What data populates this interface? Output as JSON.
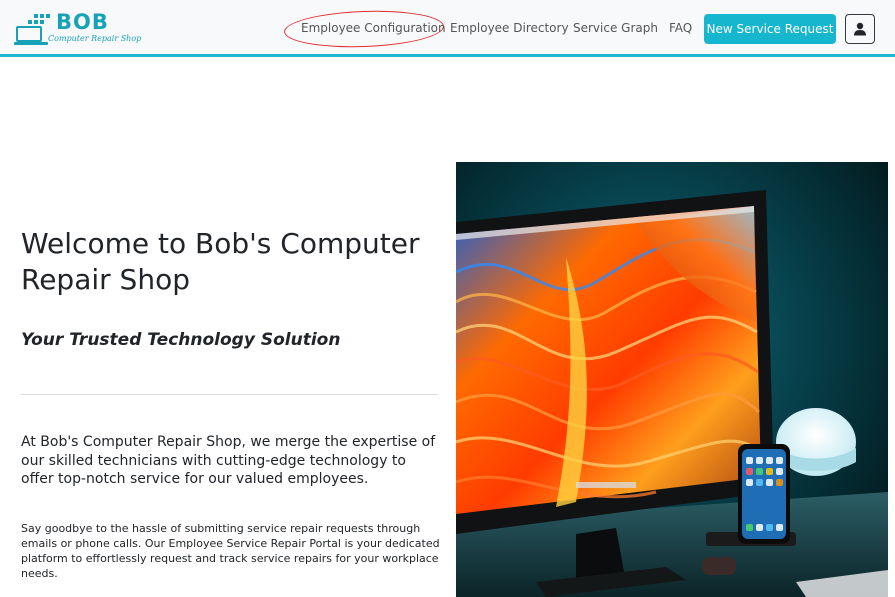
{
  "brand": {
    "name": "BOB",
    "tagline": "Computer Repair Shop",
    "color": "#17a2b8"
  },
  "nav": {
    "links": [
      {
        "label": "Employee Configuration"
      },
      {
        "label": "Employee Directory"
      },
      {
        "label": "Service Graph"
      },
      {
        "label": "FAQ"
      }
    ],
    "cta_label": "New Service Request",
    "accent_color": "#17b6cf",
    "user_icon": "user-icon"
  },
  "hero": {
    "title": "Welcome to Bob's Computer Repair Shop",
    "subtitle": "Your Trusted Technology Solution",
    "lead": "At Bob's Computer Repair Shop, we merge the expertise of our skilled technicians with cutting-edge technology to offer top-notch service for our valued employees.",
    "body": "Say goodbye to the hassle of submitting service repair requests through emails or phone calls. Our Employee Service Repair Portal is your dedicated platform to effortlessly request and track service repairs for your workplace needs."
  }
}
